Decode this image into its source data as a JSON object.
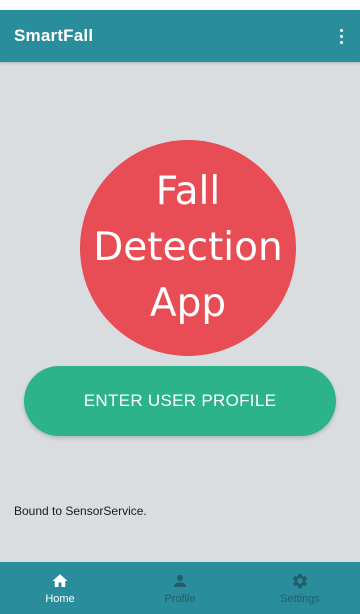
{
  "app_bar": {
    "title": "SmartFall",
    "menu_icon": "more-vertical-icon"
  },
  "hero": {
    "lines": [
      "Fall",
      "Detection",
      "App"
    ]
  },
  "enter_profile": {
    "label": "ENTER USER PROFILE"
  },
  "status": {
    "text": "Bound to SensorService."
  },
  "bottom_nav": {
    "items": [
      {
        "label": "Home",
        "icon": "home-icon",
        "active": true
      },
      {
        "label": "Profile",
        "icon": "person-icon",
        "active": false
      },
      {
        "label": "Settings",
        "icon": "gear-icon",
        "active": false
      }
    ]
  },
  "colors": {
    "primary": "#2a8d9c",
    "accent_green": "#2db38a",
    "hero_red": "#e84c54",
    "background": "#d9dde0"
  }
}
